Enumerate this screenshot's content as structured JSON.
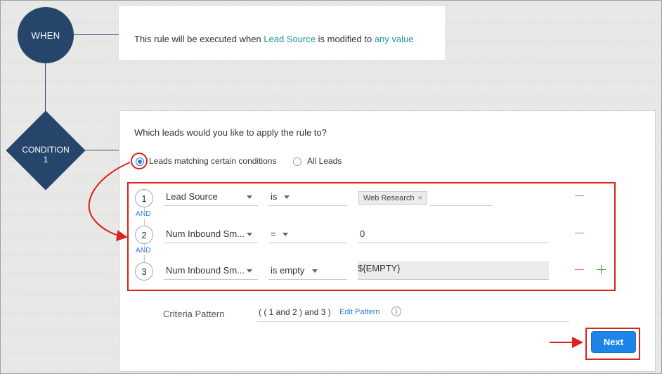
{
  "flow": {
    "when_label": "WHEN",
    "condition_label": "CONDITION",
    "condition_number": "1"
  },
  "when_card": {
    "prefix": "This rule will be executed when ",
    "field": "Lead Source",
    "middle": " is modified to ",
    "value": "any value"
  },
  "condition_card": {
    "question": "Which leads would you like to apply the rule to?",
    "options": [
      {
        "label": "Leads matching certain conditions",
        "selected": true
      },
      {
        "label": "All Leads",
        "selected": false
      }
    ],
    "rows": [
      {
        "number": "1",
        "field": "Lead Source",
        "operator": "is",
        "value_tag": "Web Research",
        "tag_remove": "×"
      },
      {
        "number": "2",
        "field": "Num Inbound Sm...",
        "operator": "=",
        "value": "0"
      },
      {
        "number": "3",
        "field": "Num Inbound Sm...",
        "operator": "is empty",
        "value": "${EMPTY}"
      }
    ],
    "connector": "AND",
    "criteria_label": "Criteria Pattern",
    "criteria_pattern": "( ( 1 and 2 ) and 3 )",
    "edit_pattern": "Edit Pattern",
    "info_glyph": "i",
    "next_button": "Next"
  },
  "colors": {
    "node": "#25456b",
    "accent_teal": "#1a9c8f",
    "link_blue": "#2d7bd6",
    "button_blue": "#1e85e8",
    "highlight_red": "#d9231c",
    "remove_red": "#e36b6b",
    "add_green": "#3d9b3d"
  }
}
